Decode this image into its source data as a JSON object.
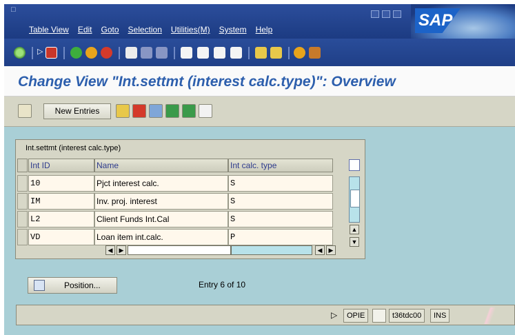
{
  "menubar": {
    "items": [
      "Table View",
      "Edit",
      "Goto",
      "Selection",
      "Utilities(M)",
      "System",
      "Help"
    ],
    "logo_text": "SAP"
  },
  "page": {
    "title": "Change View \"Int.settmt (interest calc.type)\": Overview"
  },
  "app_toolbar": {
    "new_entries_label": "New Entries"
  },
  "table": {
    "title": "Int.settmt (interest calc.type)",
    "columns": [
      "Int ID",
      "Name",
      "Int calc. type"
    ],
    "rows": [
      {
        "id": "10",
        "name": "Pjct interest calc.",
        "type": "S"
      },
      {
        "id": "IM",
        "name": "Inv. proj. interest",
        "type": "S"
      },
      {
        "id": "L2",
        "name": "Client Funds Int.Cal",
        "type": "S"
      },
      {
        "id": "VD",
        "name": "Loan item int.calc.",
        "type": "P"
      }
    ]
  },
  "footer": {
    "position_label": "Position...",
    "entry_info": "Entry 6 of 10"
  },
  "status": {
    "system": "OPIE",
    "server": "t36tdc00",
    "mode": "INS"
  },
  "colors": {
    "menu_bg": "#1c3b82",
    "title_text": "#2d5fad",
    "work_bg": "#a9cfd6",
    "panel_bg": "#d6d6c6"
  }
}
